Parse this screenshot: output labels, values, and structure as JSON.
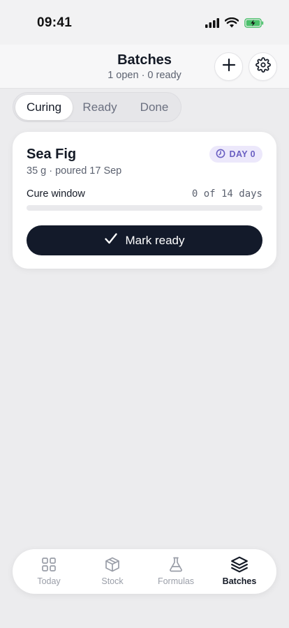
{
  "status_bar": {
    "time": "09:41"
  },
  "header": {
    "title": "Batches",
    "subtitle": "1 open · 0 ready",
    "add_icon": "plus-icon",
    "settings_icon": "gear-icon"
  },
  "segments": {
    "items": [
      {
        "label": "Curing",
        "active": true
      },
      {
        "label": "Ready",
        "active": false
      },
      {
        "label": "Done",
        "active": false
      }
    ]
  },
  "batch_card": {
    "name": "Sea Fig",
    "details": "35 g · poured 17 Sep",
    "day_badge": "DAY 0",
    "cure_label": "Cure window",
    "cure_value": "0 of 14 days",
    "cure_progress": 0.0,
    "action_label": "Mark ready",
    "accent_color": "#6a5fc2"
  },
  "tabbar": {
    "items": [
      {
        "label": "Today",
        "icon": "grid-icon"
      },
      {
        "label": "Stock",
        "icon": "box-icon"
      },
      {
        "label": "Formulas",
        "icon": "flask-icon"
      },
      {
        "label": "Batches",
        "icon": "layers-icon",
        "active": true
      }
    ]
  }
}
